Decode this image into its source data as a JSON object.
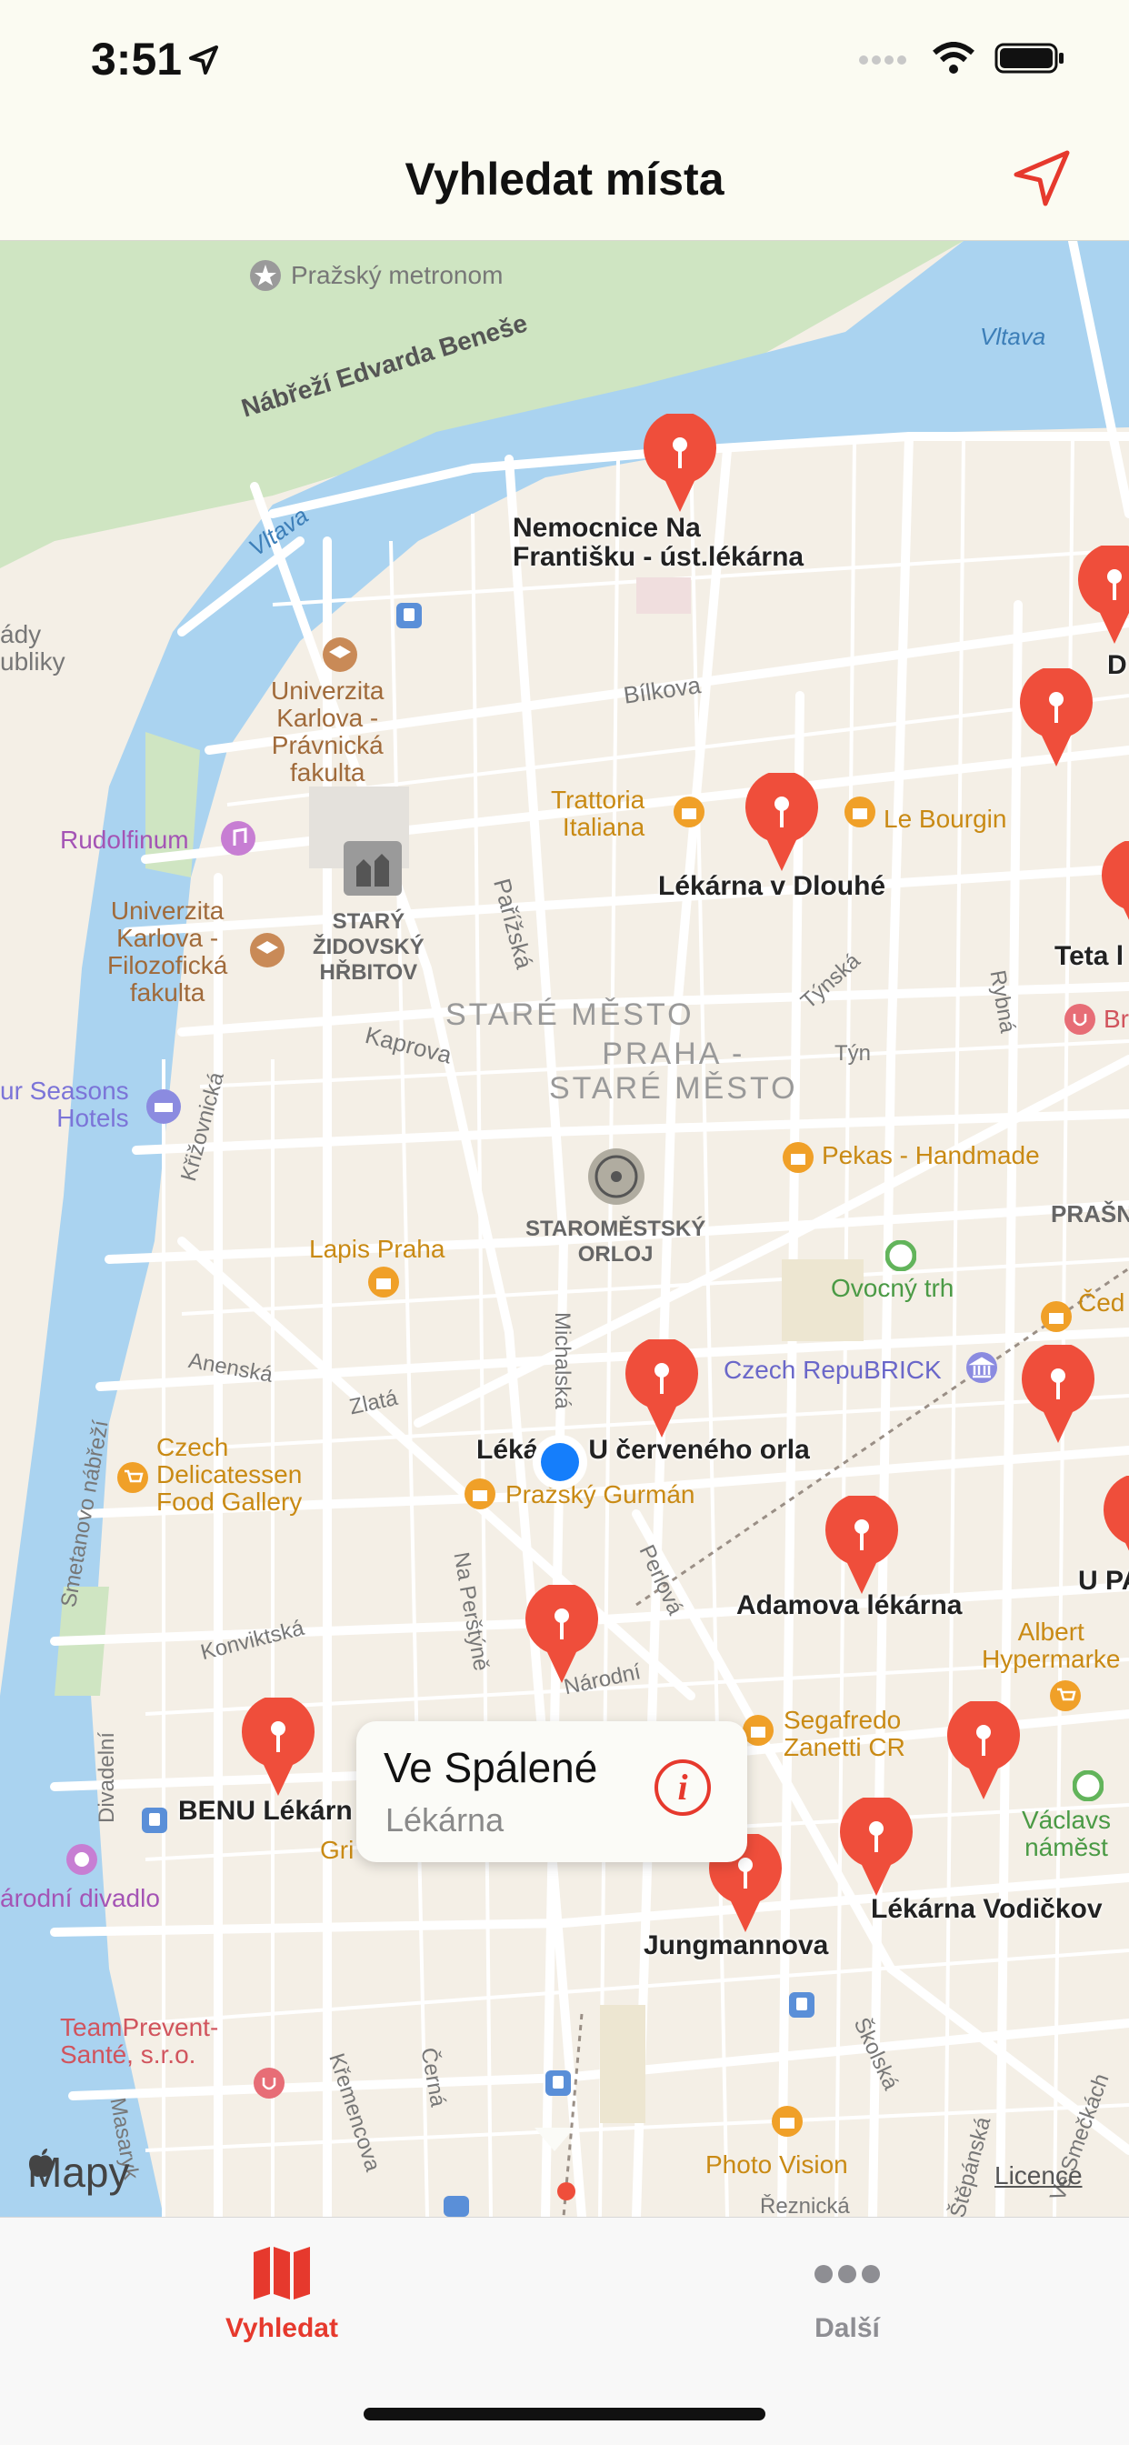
{
  "status_bar": {
    "time": "3:51"
  },
  "nav": {
    "title": "Vyhledat místa"
  },
  "map": {
    "labels": {
      "metronom": "Pražský metronom",
      "nabrezi": "Nábřeží Edvarda Beneše",
      "vltava1": "Vltava",
      "vltava2": "Vltava",
      "bilkova": "Bílkova",
      "pravnicka": "Univerzita\nKarlova -\nPrávnická\nfakulta",
      "rudolfinum": "Rudolfinum",
      "filozoficka": "Univerzita\nKarlova -\nFilozofická\nfakulta",
      "zidovsky": "STARÝ\nŽIDOVSKÝ\nHŘBITOV",
      "parizska": "Pařížská",
      "stare_mesto": "STARÉ MĚSTO",
      "praha_stare": "PRAHA -\nSTARÉ MĚSTO",
      "kaprova": "Kaprova",
      "seasons": "ur Seasons\nHotels",
      "krizovnicka": "Křižovnická",
      "orloj": "STAROMĚSTSKÝ\nORLOJ",
      "lapis": "Lapis Praha",
      "trattoria": "Trattoria\nItaliana",
      "bourgin": "Le Bourgin",
      "tynska": "Týnská",
      "tyn": "Týn",
      "rybna": "Rybná",
      "pekas": "Pekas - Handmade",
      "ovocny": "Ovocný trh",
      "repubrick": "Czech RepuBRICK",
      "anenska": "Anenská",
      "zlata": "Zlatá",
      "michalska": "Michalská",
      "czech_deli": "Czech\nDelicatessen\nFood Gallery",
      "gurman": "Pražský Gurmán",
      "konviktska": "Konviktská",
      "na_perstyne": "Na Perštýně",
      "perlova": "Perlová",
      "narodni": "Národní",
      "albert": "Albert\nHypermarke",
      "segafredo": "Segafredo\nZanetti CR",
      "vaclavske": "Václavs\nnáměst",
      "narodni_divadlo": "árodní divadlo",
      "divadelni": "Divadelní",
      "teamprevent": "TeamPrevent-\nSanté, s.r.o.",
      "photo_vision": "Photo Vision",
      "krem": "Křemencova",
      "cerna": "Černá",
      "skolska": "Školská",
      "stepanska": "Štěpánská",
      "smeckach": "Ve Smečkách",
      "reznicka": "Řeznická",
      "masaryk": "Masaryk",
      "smetanovo": "Smetanovo nábřeží",
      "ady": "ády\nubliky",
      "prasn": "PRAŠN",
      "ced": "Čed",
      "gri": "Gri",
      "br": "Br"
    },
    "pharmacies": [
      {
        "name": "Nemocnice Na\nFrantišku - úst.lékárna"
      },
      {
        "name": "Lékárna v Dlouhé"
      },
      {
        "name": "Lékárna U červeného orla"
      },
      {
        "name": "Adamova lékárna"
      },
      {
        "name": "BENU Lékárn"
      },
      {
        "name": "Jungmannova"
      },
      {
        "name": "Lékárna Vodičkov"
      },
      {
        "name": "Teta l"
      },
      {
        "name": "D"
      },
      {
        "name": "U PA"
      }
    ],
    "attribution": {
      "logo": "Mapy",
      "licence": "Licence"
    }
  },
  "callout": {
    "title": "Ve Spálené",
    "subtitle": "Lékárna"
  },
  "tabs": [
    {
      "label": "Vyhledat",
      "active": true,
      "icon": "map-icon",
      "color": "#e6392d"
    },
    {
      "label": "Další",
      "active": false,
      "icon": "more-icon",
      "color": "#8e8e93"
    }
  ],
  "colors": {
    "accent": "#e6392d",
    "water": "#aad3f0",
    "park": "#cfe5c2",
    "land": "#f4efe6",
    "road": "#ffffff"
  }
}
